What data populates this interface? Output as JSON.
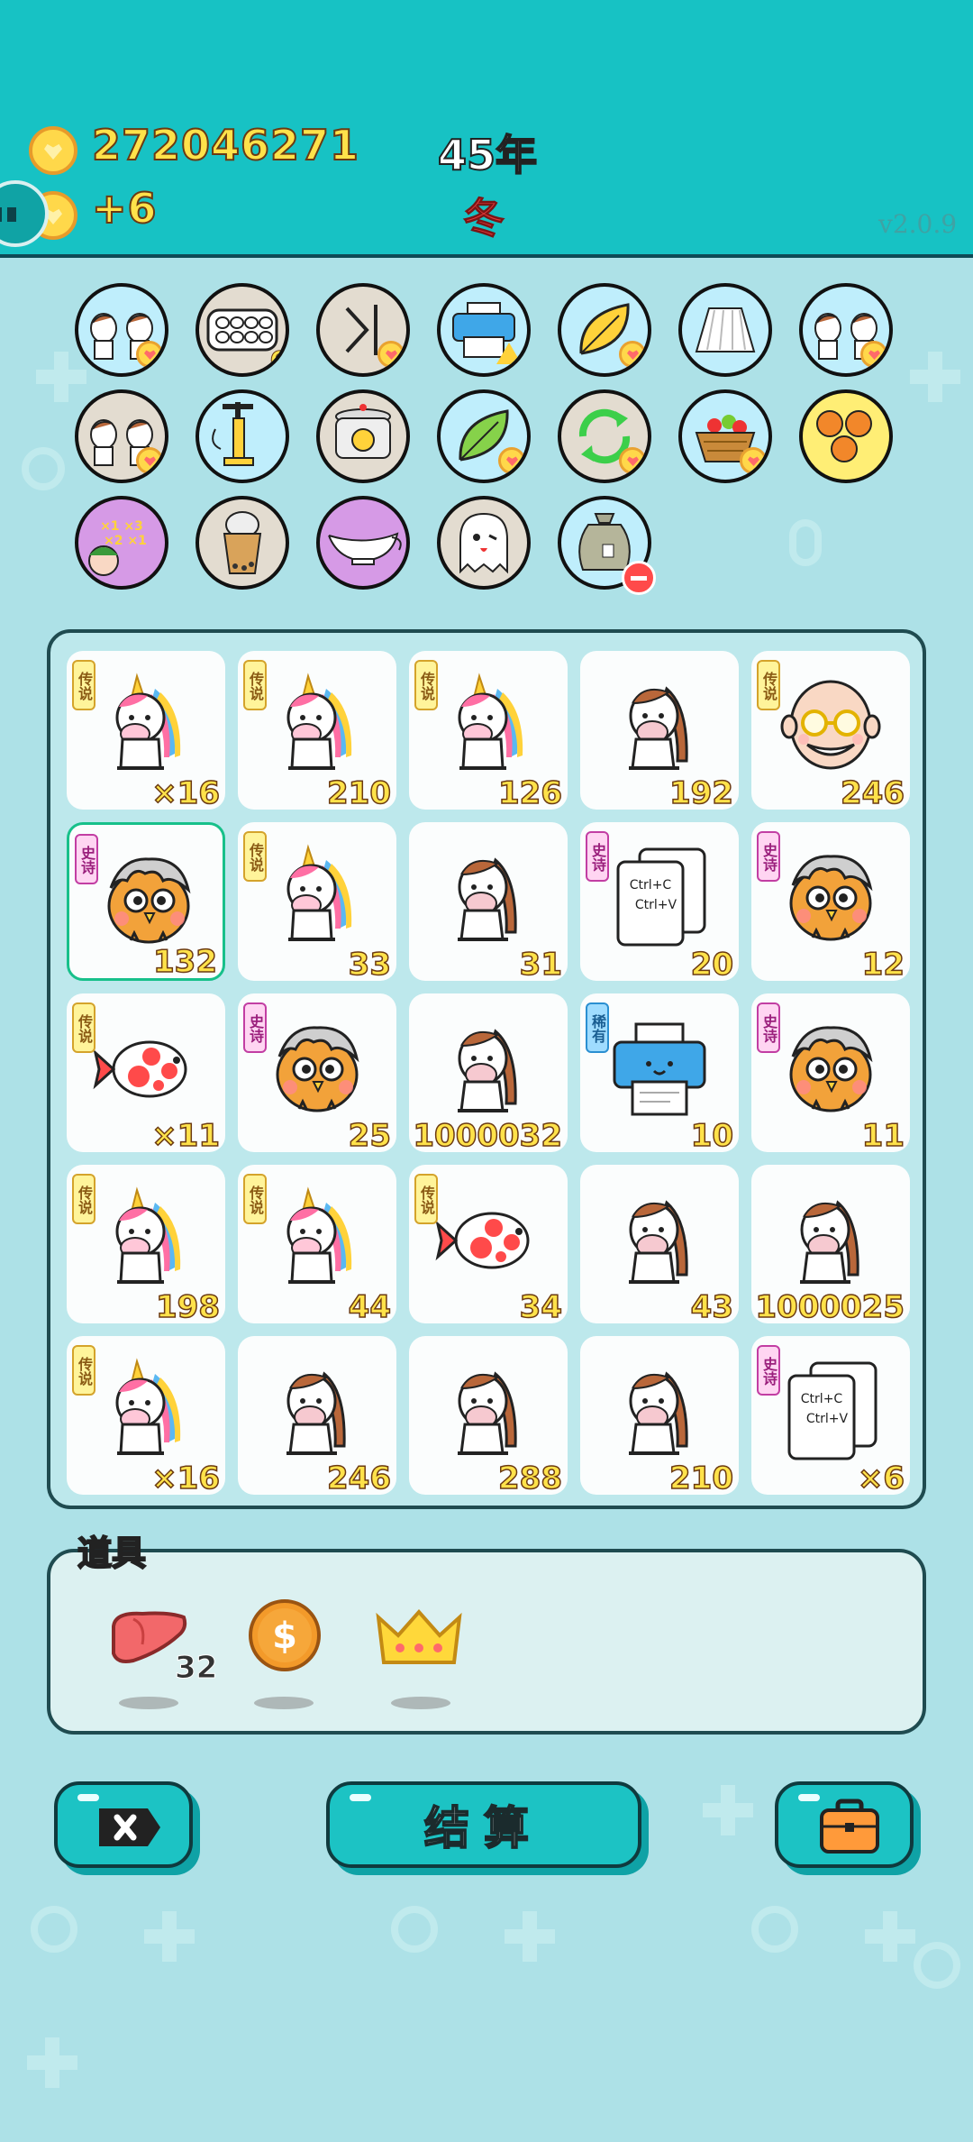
{
  "header": {
    "coins": "272046271",
    "coin_delta": "+6",
    "year": "45年",
    "season": "冬",
    "version": "v2.0.9"
  },
  "skills": [
    {
      "name": "cow-pair-icon",
      "bg": "#bfeefc",
      "badge": "heart"
    },
    {
      "name": "egg-tray-icon",
      "bg": "#e3dcd0",
      "badge": "6"
    },
    {
      "name": "skip-arrow-icon",
      "bg": "#e3dcd0",
      "badge": "heart"
    },
    {
      "name": "printer-icon",
      "bg": "#bfeefc",
      "badge": "warning"
    },
    {
      "name": "yellow-leaf-icon",
      "bg": "#bfeefc",
      "badge": "heart"
    },
    {
      "name": "skirt-icon",
      "bg": "#bfeefc",
      "badge": ""
    },
    {
      "name": "cow-pair-icon",
      "bg": "#bfeefc",
      "badge": "heart"
    },
    {
      "name": "cow-pair-icon",
      "bg": "#e3dcd0",
      "badge": "heart"
    },
    {
      "name": "air-pump-icon",
      "bg": "#bfeefc",
      "badge": ""
    },
    {
      "name": "duck-pot-icon",
      "bg": "#e3dcd0",
      "badge": ""
    },
    {
      "name": "green-leaf-icon",
      "bg": "#bfeefc",
      "badge": "heart"
    },
    {
      "name": "recycle-arrows-icon",
      "bg": "#e3dcd0",
      "badge": "heart"
    },
    {
      "name": "fruit-basket-icon",
      "bg": "#bfeefc",
      "badge": "heart"
    },
    {
      "name": "basketballs-icon",
      "bg": "#ffee75",
      "badge": ""
    },
    {
      "name": "multiplier-grandpa-icon",
      "bg": "#d69ae6",
      "badge": ""
    },
    {
      "name": "bubble-tea-icon",
      "bg": "#e3dcd0",
      "badge": ""
    },
    {
      "name": "gravy-boat-icon",
      "bg": "#d69ae6",
      "badge": ""
    },
    {
      "name": "ghost-icon",
      "bg": "#e3dcd0",
      "badge": ""
    },
    {
      "name": "trash-bag-icon",
      "bg": "#bfeefc",
      "badge": "minus"
    }
  ],
  "board": {
    "cells": [
      {
        "art": "unicorn",
        "tag": "传说",
        "tag_type": "legend",
        "count": "×16"
      },
      {
        "art": "unicorn",
        "tag": "传说",
        "tag_type": "legend",
        "count": "210"
      },
      {
        "art": "unicorn",
        "tag": "传说",
        "tag_type": "legend",
        "count": "126"
      },
      {
        "art": "cow",
        "tag": "",
        "tag_type": "",
        "count": "192"
      },
      {
        "art": "grandpa",
        "tag": "传说",
        "tag_type": "legend",
        "count": "246"
      },
      {
        "art": "bird",
        "tag": "史诗",
        "tag_type": "epic",
        "count": "132"
      },
      {
        "art": "unicorn",
        "tag": "传说",
        "tag_type": "legend",
        "count": "33"
      },
      {
        "art": "cow",
        "tag": "",
        "tag_type": "",
        "count": "31"
      },
      {
        "art": "ctrl",
        "tag": "史诗",
        "tag_type": "epic",
        "count": "20"
      },
      {
        "art": "bird",
        "tag": "史诗",
        "tag_type": "epic",
        "count": "12"
      },
      {
        "art": "fish",
        "tag": "传说",
        "tag_type": "legend",
        "count": "×11"
      },
      {
        "art": "bird",
        "tag": "史诗",
        "tag_type": "epic",
        "count": "25"
      },
      {
        "art": "cow",
        "tag": "",
        "tag_type": "",
        "count": "1000032"
      },
      {
        "art": "printer",
        "tag": "稀有",
        "tag_type": "rare",
        "count": "10"
      },
      {
        "art": "bird",
        "tag": "史诗",
        "tag_type": "epic",
        "count": "11"
      },
      {
        "art": "unicorn",
        "tag": "传说",
        "tag_type": "legend",
        "count": "198"
      },
      {
        "art": "unicorn",
        "tag": "传说",
        "tag_type": "legend",
        "count": "44"
      },
      {
        "art": "fish",
        "tag": "传说",
        "tag_type": "legend",
        "count": "34"
      },
      {
        "art": "cow",
        "tag": "",
        "tag_type": "",
        "count": "43"
      },
      {
        "art": "cow",
        "tag": "",
        "tag_type": "",
        "count": "1000025"
      },
      {
        "art": "unicorn",
        "tag": "传说",
        "tag_type": "legend",
        "count": "×16"
      },
      {
        "art": "cow",
        "tag": "",
        "tag_type": "",
        "count": "246"
      },
      {
        "art": "cow",
        "tag": "",
        "tag_type": "",
        "count": "288"
      },
      {
        "art": "cow",
        "tag": "",
        "tag_type": "",
        "count": "210"
      },
      {
        "art": "ctrl",
        "tag": "史诗",
        "tag_type": "epic",
        "count": "×6"
      }
    ],
    "selected_index": 5,
    "ctrl_lines": [
      "Ctrl+C",
      "Ctrl+V"
    ]
  },
  "items": {
    "title": "道具",
    "list": [
      {
        "name": "liver-icon",
        "count": "32"
      },
      {
        "name": "dollar-coin-icon",
        "count": ""
      },
      {
        "name": "crown-icon",
        "count": ""
      }
    ]
  },
  "buttons": {
    "exit": "exit-icon",
    "settle": "结算",
    "bag": "briefcase-icon"
  },
  "colors": {
    "header_bg": "#17c2c4",
    "page_bg": "#ade1e7",
    "count_text": "#ffe24a"
  }
}
